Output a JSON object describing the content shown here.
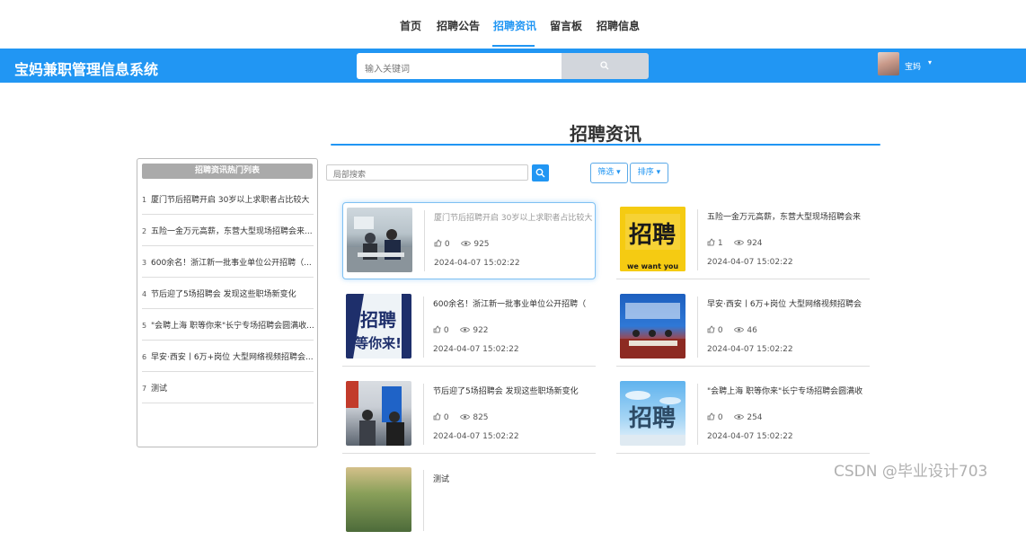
{
  "topnav": {
    "items": [
      {
        "label": "首页"
      },
      {
        "label": "招聘公告"
      },
      {
        "label": "招聘资讯"
      },
      {
        "label": "留言板"
      },
      {
        "label": "招聘信息"
      }
    ],
    "active_index": 2
  },
  "header": {
    "app_title": "宝妈兼职管理信息系统",
    "search_placeholder": "输入关键词",
    "user_name": "宝妈"
  },
  "page_title": "招聘资讯",
  "sidebar": {
    "title": "招聘资讯热门列表",
    "items": [
      {
        "num": "1",
        "text": "厦门节后招聘开启 30岁以上求职者占比较大"
      },
      {
        "num": "2",
        "text": "五险一金万元高薪，东营大型现场招聘会来..."
      },
      {
        "num": "3",
        "text": "600余名！浙江新一批事业单位公开招聘（..."
      },
      {
        "num": "4",
        "text": "节后迎了5场招聘会 发现这些职场新变化"
      },
      {
        "num": "5",
        "text": "\"会聘上海 职等你来\"长宁专场招聘会圆满收..."
      },
      {
        "num": "6",
        "text": "早安·西安丨6万+岗位 大型网络视频招聘会..."
      },
      {
        "num": "7",
        "text": "测试"
      }
    ]
  },
  "filters": {
    "local_search_placeholder": "局部搜索",
    "filter_label": "筛选",
    "sort_label": "排序"
  },
  "cards": [
    {
      "title": "厦门节后招聘开启 30岁以上求职者占比较大",
      "likes": "0",
      "views": "925",
      "date": "2024-04-07 15:02:22",
      "thumb": "office-meeting-photo"
    },
    {
      "title": "五险一金万元高薪，东营大型现场招聘会来",
      "likes": "1",
      "views": "924",
      "date": "2024-04-07 15:02:22",
      "thumb": "recruitment-poster-yellow",
      "thumb_text": "招聘",
      "thumb_sub": "we want you"
    },
    {
      "title": "600余名！浙江新一批事业单位公开招聘（",
      "likes": "0",
      "views": "922",
      "date": "2024-04-07 15:02:22",
      "thumb": "recruitment-graphic-navy",
      "thumb_text": "招聘",
      "thumb_sub": "等你来!"
    },
    {
      "title": "早安·西安丨6万+岗位 大型网络视频招聘会",
      "likes": "0",
      "views": "46",
      "date": "2024-04-07 15:02:22",
      "thumb": "conference-stage-photo"
    },
    {
      "title": "节后迎了5场招聘会 发现这些职场新变化",
      "likes": "0",
      "views": "825",
      "date": "2024-04-07 15:02:22",
      "thumb": "job-fair-photo"
    },
    {
      "title": "\"会聘上海 职等你来\"长宁专场招聘会圆满收",
      "likes": "0",
      "views": "254",
      "date": "2024-04-07 15:02:22",
      "thumb": "recruitment-3d-text",
      "thumb_text": "招聘"
    },
    {
      "title": "测试",
      "thumb": "trees-photo"
    }
  ],
  "watermark": "CSDN @毕业设计703",
  "colors": {
    "primary": "#2196f3",
    "header_bg": "#2196f3",
    "sidebar_head": "#aaaaaa"
  }
}
